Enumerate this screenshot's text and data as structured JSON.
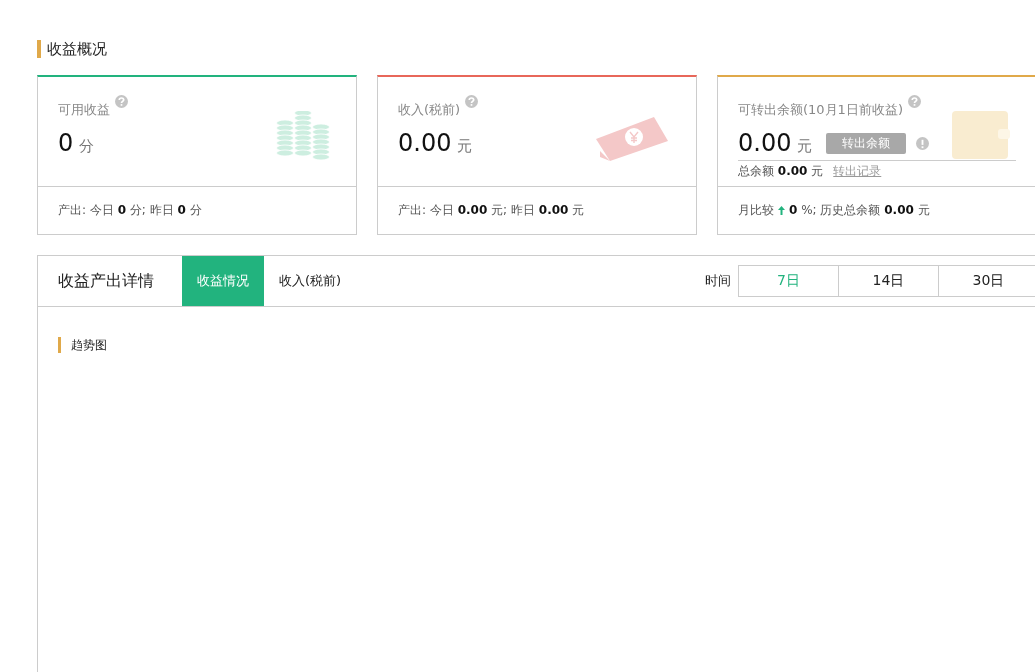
{
  "overview": {
    "title": "收益概况",
    "cards": [
      {
        "kind": "coins",
        "color": "#22b37e",
        "label": "可用收益",
        "value": "0",
        "unit": "分",
        "footer": "产出: 今日 **0** 分; 昨日 **0** 分"
      },
      {
        "kind": "money",
        "color": "#e8675a",
        "label": "收入(税前)",
        "value": "0.00",
        "unit": "元",
        "footer": "产出: 今日 **0.00** 元; 昨日 **0.00** 元"
      },
      {
        "kind": "wallet",
        "color": "#e0a94a",
        "label": "可转出余额(10月1日前收益)",
        "value": "0.00",
        "unit": "元",
        "button": {
          "label": "转出余额",
          "disabled": true
        },
        "balance": "总余额 **0.00** 元",
        "link": "转出记录",
        "footer_prefix": "月比较",
        "footer": "**0** %; 历史总余额 **0.00** 元"
      }
    ]
  },
  "detail": {
    "title": "收益产出详情",
    "tabs": [
      {
        "label": "收益情况",
        "selected": true
      },
      {
        "label": "收入(税前)",
        "selected": false
      }
    ],
    "time_label": "时间",
    "ranges": [
      {
        "label": "7日",
        "selected": true
      },
      {
        "label": "14日",
        "selected": false
      },
      {
        "label": "30日",
        "selected": false
      }
    ],
    "section_title": "趋势图"
  }
}
